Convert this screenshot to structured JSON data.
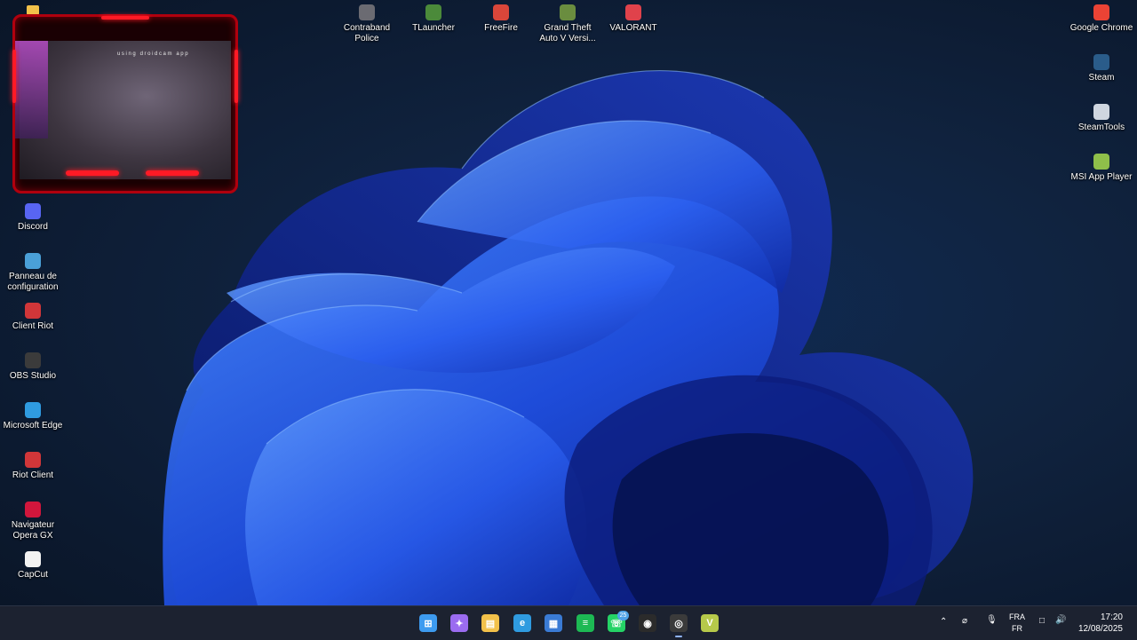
{
  "desktop": {
    "top_icons": [
      {
        "label": "Contraband Police",
        "icon": "contraband-icon",
        "color": "#6b6b72"
      },
      {
        "label": "TLauncher",
        "icon": "tlauncher-icon",
        "color": "#4b8a3a"
      },
      {
        "label": "FreeFire",
        "icon": "freefire-icon",
        "color": "#d9463a"
      },
      {
        "label": "Grand Theft Auto V Versi...",
        "icon": "gta-icon",
        "color": "#6a8d3f"
      },
      {
        "label": "VALORANT",
        "icon": "valorant-icon",
        "color": "#e0424b"
      }
    ],
    "left_icons": [
      {
        "label": "Discord",
        "icon": "discord-icon",
        "color": "#5865f2"
      },
      {
        "label": "Panneau de configuration",
        "icon": "control-panel-icon",
        "color": "#4aa0d8"
      },
      {
        "label": "Client Riot",
        "icon": "riot-icon",
        "color": "#d13639"
      },
      {
        "label": "OBS Studio",
        "icon": "obs-icon",
        "color": "#3b3b3b"
      },
      {
        "label": "Microsoft Edge",
        "icon": "edge-icon",
        "color": "#2f9be0"
      },
      {
        "label": "Riot Client",
        "icon": "riot-client-icon",
        "color": "#d13639"
      },
      {
        "label": "Navigateur Opera GX",
        "icon": "opera-gx-icon",
        "color": "#d1163c"
      },
      {
        "label": "CapCut",
        "icon": "capcut-icon",
        "color": "#f2f2f2"
      }
    ],
    "right_icons": [
      {
        "label": "Google Chrome",
        "icon": "chrome-icon",
        "color": "#ea4335"
      },
      {
        "label": "Steam",
        "icon": "steam-icon",
        "color": "#2a5c8a"
      },
      {
        "label": "SteamTools",
        "icon": "steamtools-icon",
        "color": "#cfd6e0"
      },
      {
        "label": "MSI App Player",
        "icon": "msi-player-icon",
        "color": "#8fbf4a"
      }
    ]
  },
  "camera_overlay": {
    "caption": "using droidcam app"
  },
  "taskbar": {
    "apps": [
      {
        "name": "start",
        "icon": "windows-start-icon",
        "color": "#3d9bf0",
        "active": false
      },
      {
        "name": "copilot",
        "icon": "copilot-icon",
        "color": "#9b6cf0",
        "active": false
      },
      {
        "name": "file-explorer",
        "icon": "folder-icon",
        "color": "#f2c14a",
        "active": false
      },
      {
        "name": "edge",
        "icon": "edge-icon",
        "color": "#2f9be0",
        "active": false
      },
      {
        "name": "store",
        "icon": "store-icon",
        "color": "#3a7bd5",
        "active": false
      },
      {
        "name": "spotify",
        "icon": "spotify-icon",
        "color": "#1db954",
        "active": false
      },
      {
        "name": "whatsapp",
        "icon": "whatsapp-icon",
        "color": "#25d366",
        "active": false
      },
      {
        "name": "app",
        "icon": "circle-app-icon",
        "color": "#2b2b2b",
        "active": false
      },
      {
        "name": "obs",
        "icon": "obs-icon",
        "color": "#3b3b3b",
        "active": true
      },
      {
        "name": "app-v",
        "icon": "v-app-icon",
        "color": "#b6c94a",
        "active": false
      }
    ],
    "whatsapp_badge": "25",
    "language": {
      "line1": "FRA",
      "line2": "FR"
    },
    "time": "17:20",
    "date": "12/08/2025"
  }
}
